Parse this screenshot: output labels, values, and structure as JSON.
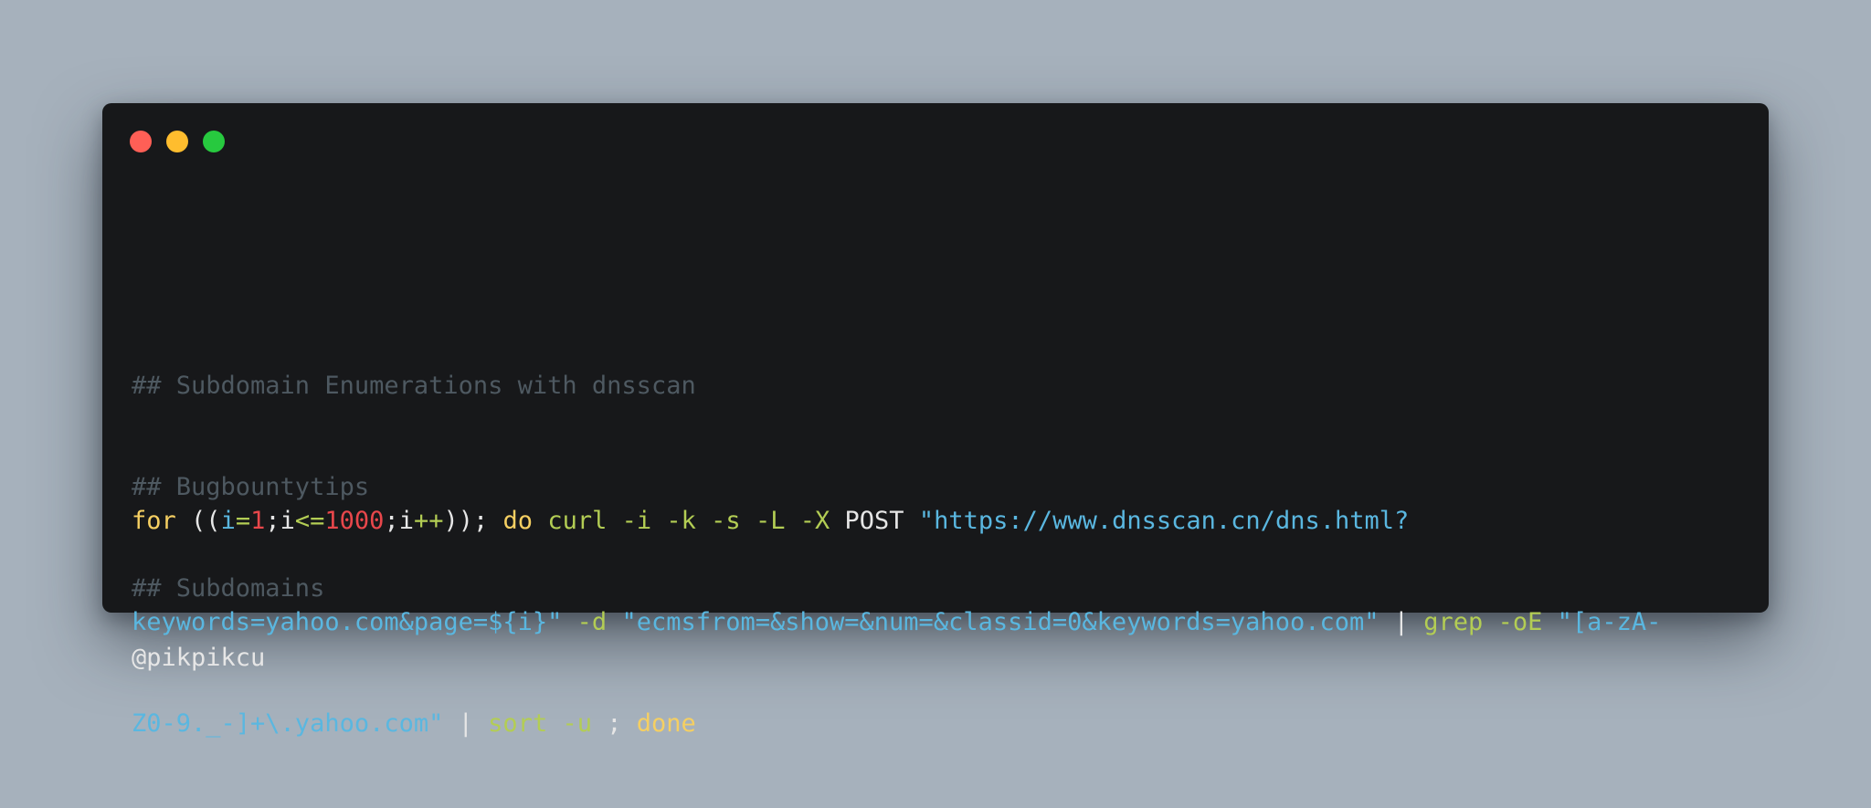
{
  "comments": [
    "## Subdomain Enumerations with dnsscan",
    "## Bugbountytips",
    "## Subdomains"
  ],
  "command": {
    "line1": [
      {
        "t": "for",
        "c": "kw"
      },
      {
        "t": " ",
        "c": "plain"
      },
      {
        "t": "((",
        "c": "plain"
      },
      {
        "t": "i",
        "c": "var"
      },
      {
        "t": "=",
        "c": "op"
      },
      {
        "t": "1",
        "c": "num"
      },
      {
        "t": ";",
        "c": "plain"
      },
      {
        "t": "i",
        "c": "plain"
      },
      {
        "t": "<=",
        "c": "op"
      },
      {
        "t": "1000",
        "c": "num"
      },
      {
        "t": ";",
        "c": "plain"
      },
      {
        "t": "i",
        "c": "plain"
      },
      {
        "t": "++",
        "c": "op"
      },
      {
        "t": "));",
        "c": "plain"
      },
      {
        "t": " ",
        "c": "plain"
      },
      {
        "t": "do",
        "c": "kw"
      },
      {
        "t": " ",
        "c": "plain"
      },
      {
        "t": "curl",
        "c": "fn"
      },
      {
        "t": " ",
        "c": "plain"
      },
      {
        "t": "-i",
        "c": "fn"
      },
      {
        "t": " ",
        "c": "plain"
      },
      {
        "t": "-k",
        "c": "fn"
      },
      {
        "t": " ",
        "c": "plain"
      },
      {
        "t": "-s",
        "c": "fn"
      },
      {
        "t": " ",
        "c": "plain"
      },
      {
        "t": "-L",
        "c": "fn"
      },
      {
        "t": " ",
        "c": "plain"
      },
      {
        "t": "-X",
        "c": "fn"
      },
      {
        "t": " ",
        "c": "plain"
      },
      {
        "t": "POST",
        "c": "plain"
      },
      {
        "t": " ",
        "c": "plain"
      },
      {
        "t": "\"https://www.dnsscan.cn/dns.html?",
        "c": "str"
      }
    ],
    "line2": [
      {
        "t": "keywords=yahoo.com&page=${i}\"",
        "c": "str"
      },
      {
        "t": " ",
        "c": "plain"
      },
      {
        "t": "-d",
        "c": "fn"
      },
      {
        "t": " ",
        "c": "plain"
      },
      {
        "t": "\"ecmsfrom=&show=&num=&classid=0&keywords=yahoo.com\"",
        "c": "str"
      },
      {
        "t": " ",
        "c": "plain"
      },
      {
        "t": "|",
        "c": "plain"
      },
      {
        "t": " ",
        "c": "plain"
      },
      {
        "t": "grep",
        "c": "fn"
      },
      {
        "t": " ",
        "c": "plain"
      },
      {
        "t": "-oE",
        "c": "fn"
      },
      {
        "t": " ",
        "c": "plain"
      },
      {
        "t": "\"[a-zA-",
        "c": "str"
      }
    ],
    "line3": [
      {
        "t": "Z0-9._-]+\\.yahoo.com\"",
        "c": "str"
      },
      {
        "t": " ",
        "c": "plain"
      },
      {
        "t": "|",
        "c": "plain"
      },
      {
        "t": " ",
        "c": "plain"
      },
      {
        "t": "sort",
        "c": "fn"
      },
      {
        "t": " ",
        "c": "plain"
      },
      {
        "t": "-u",
        "c": "fn"
      },
      {
        "t": " ",
        "c": "plain"
      },
      {
        "t": ";",
        "c": "plain"
      },
      {
        "t": " ",
        "c": "plain"
      },
      {
        "t": "done",
        "c": "kw"
      }
    ]
  },
  "handle": "@pikpikcu",
  "colors": {
    "background": "#a6b1bc",
    "window": "#17181a",
    "dot_red": "#ff5f56",
    "dot_yellow": "#ffbd2e",
    "dot_green": "#27c93f",
    "comment": "#4e5961",
    "keyword": "#f5cf62",
    "variable": "#5ab7e0",
    "number": "#e8474b",
    "function": "#b3cd54",
    "string": "#5ab7e0",
    "text": "#e6e6e6"
  }
}
